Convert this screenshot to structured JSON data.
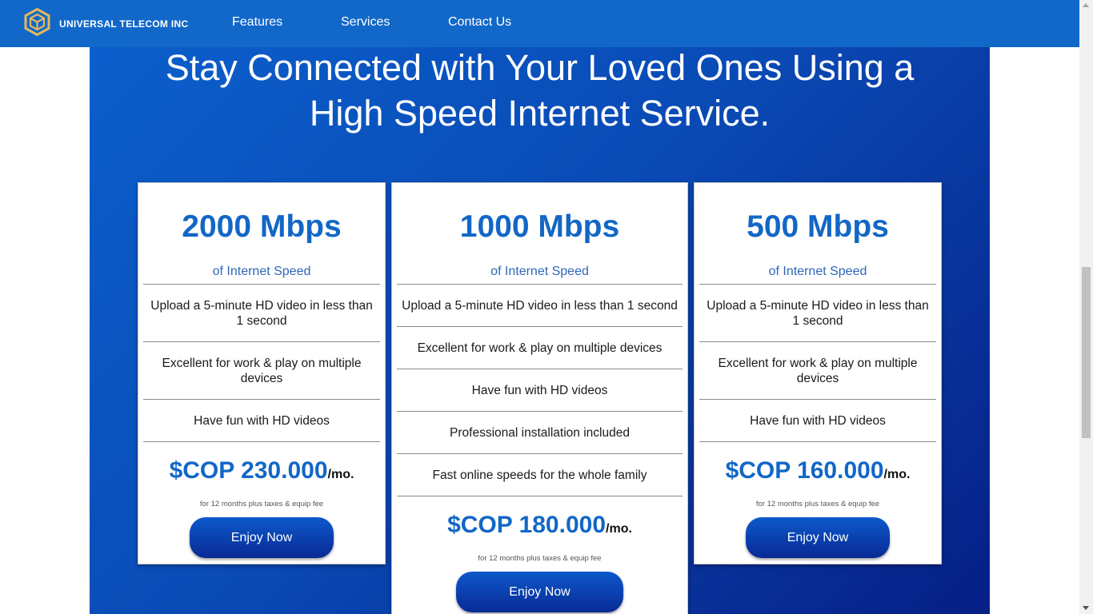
{
  "header": {
    "brand": "UNIVERSAL TELECOM INC",
    "nav": [
      "Features",
      "Services",
      "Contact Us"
    ]
  },
  "hero": {
    "title_line1": "Stay Connected with Your Loved Ones Using a",
    "title_line2": "High Speed Internet Service."
  },
  "plans": [
    {
      "speed": "2000 Mbps",
      "speed_sub": "of Internet Speed",
      "features": [
        "Upload a 5-minute HD video in less than 1 second",
        "Excellent for work & play on multiple devices",
        "Have fun with HD videos"
      ],
      "price": "$COP 230.000",
      "per": "/mo.",
      "fine_print": "for 12 months plus taxes & equip fee",
      "cta": "Enjoy Now"
    },
    {
      "speed": "1000 Mbps",
      "speed_sub": "of Internet Speed",
      "features": [
        "Upload a 5-minute HD video in less than 1 second",
        "Excellent for work & play on multiple devices",
        "Have fun with HD videos",
        "Professional installation included",
        "Fast online speeds for the whole family"
      ],
      "price": "$COP 180.000",
      "per": "/mo.",
      "fine_print": "for 12 months plus taxes & equip fee",
      "cta": "Enjoy Now"
    },
    {
      "speed": "500 Mbps",
      "speed_sub": "of Internet Speed",
      "features": [
        "Upload a 5-minute HD video in less than 1 second",
        "Excellent for work & play on multiple devices",
        "Have fun with HD videos"
      ],
      "price": "$COP 160.000",
      "per": "/mo.",
      "fine_print": "for 12 months plus taxes & equip fee",
      "cta": "Enjoy Now"
    }
  ],
  "colors": {
    "header_bg": "#1168c9",
    "accent_blue": "#1267c6",
    "hero_gradient_dark": "#061f86",
    "button_dark": "#082a94"
  },
  "icons": {
    "logo": "hexagon-cube-logo-icon"
  }
}
